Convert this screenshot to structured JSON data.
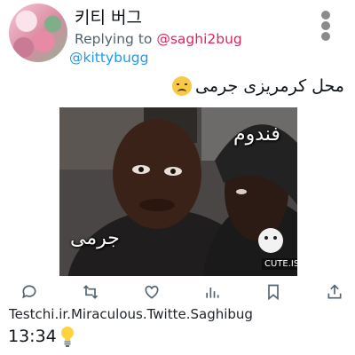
{
  "tweet": {
    "display_name": "키티 버그",
    "replying_prefix": "Replying to",
    "replying_to": "@saghi2bug",
    "handle": "@kittybugg",
    "text": "محل کرمریزی جرمی",
    "emoji": "sad-face-emoji",
    "media": {
      "label_right": "فندوم",
      "label_left": "جرمی",
      "watermark": "CUTE.ISH"
    },
    "source": "Testchi.ir.Miraculous.Twitte.Saghibug",
    "time": "13:34",
    "time_emoji": "lightbulb-icon"
  },
  "actions": [
    {
      "name": "reply",
      "icon": "reply-icon"
    },
    {
      "name": "retweet",
      "icon": "retweet-icon"
    },
    {
      "name": "like",
      "icon": "heart-icon"
    },
    {
      "name": "views",
      "icon": "analytics-icon"
    },
    {
      "name": "bookmark",
      "icon": "bookmark-icon"
    },
    {
      "name": "share",
      "icon": "share-icon"
    }
  ],
  "colors": {
    "mention": "#e0245e",
    "handle": "#1d9bf0",
    "icon_gray": "#536471"
  }
}
